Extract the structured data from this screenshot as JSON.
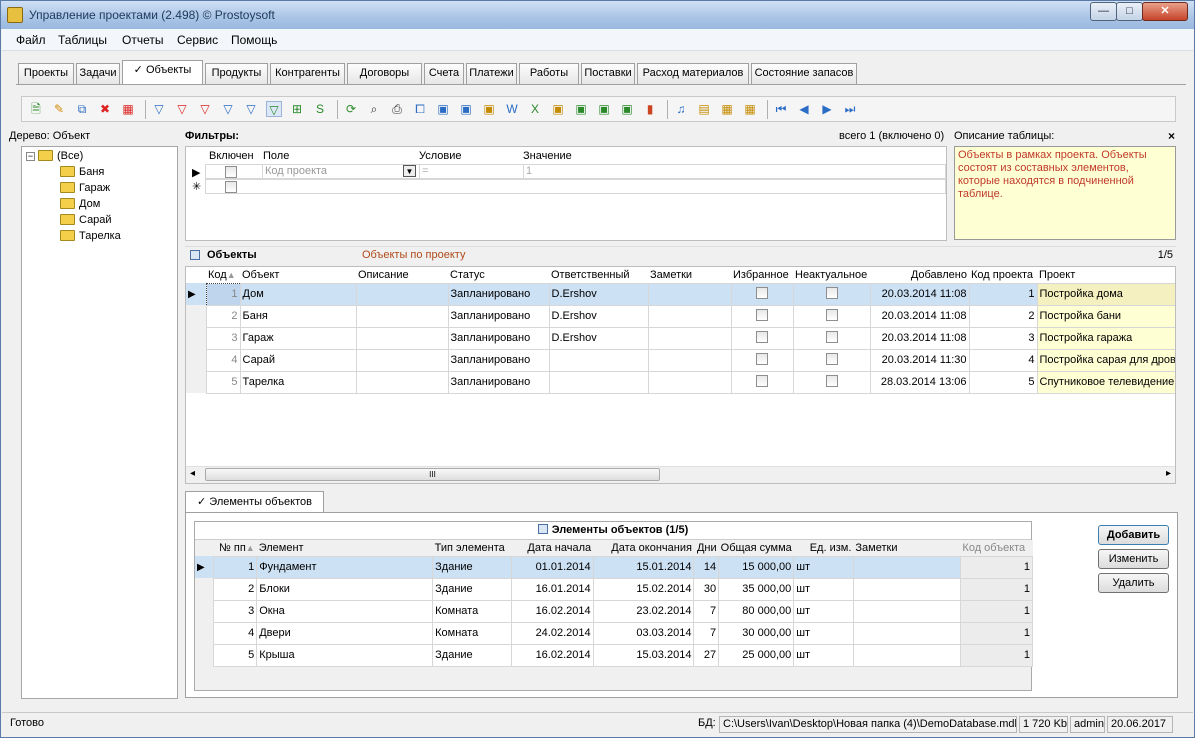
{
  "window": {
    "title": "Управление проектами (2.498) © Prostoysoft",
    "min": "—",
    "max": "□",
    "close": "✕"
  },
  "menu": [
    "Файл",
    "Таблицы",
    "Отчеты",
    "Сервис",
    "Помощь"
  ],
  "tabs": [
    {
      "label": "Проекты",
      "active": false
    },
    {
      "label": "Задачи",
      "active": false
    },
    {
      "label": "✓ Объекты",
      "active": true
    },
    {
      "label": "Продукты",
      "active": false
    },
    {
      "label": "Контрагенты",
      "active": false
    },
    {
      "label": "Договоры",
      "active": false
    },
    {
      "label": "Счета",
      "active": false
    },
    {
      "label": "Платежи",
      "active": false
    },
    {
      "label": "Работы",
      "active": false
    },
    {
      "label": "Поставки",
      "active": false
    },
    {
      "label": "Расход материалов",
      "active": false
    },
    {
      "label": "Состояние запасов",
      "active": false
    }
  ],
  "toolbar_icons": [
    {
      "name": "new-record-icon",
      "glyph": "🗎",
      "color": "#2a8a2a"
    },
    {
      "name": "edit-record-icon",
      "glyph": "✎",
      "color": "#d08a00"
    },
    {
      "name": "copy-record-icon",
      "glyph": "⧉",
      "color": "#2b6cc4"
    },
    {
      "name": "delete-record-icon",
      "glyph": "✖",
      "color": "#d22"
    },
    {
      "name": "delete-all-icon",
      "glyph": "▦",
      "color": "#d22"
    },
    {
      "name": "filter-icon",
      "glyph": "▽",
      "color": "#2b6cc4"
    },
    {
      "name": "filter-remove-icon",
      "glyph": "▽",
      "color": "#d22"
    },
    {
      "name": "filter-clear-icon",
      "glyph": "▽",
      "color": "#d22"
    },
    {
      "name": "filter-add-icon",
      "glyph": "▽",
      "color": "#2b6cc4"
    },
    {
      "name": "filter-edit-icon",
      "glyph": "▽",
      "color": "#2b6cc4"
    },
    {
      "name": "filter-panel-icon",
      "glyph": "▽",
      "color": "#2a8a2a"
    },
    {
      "name": "filter-tree-icon",
      "glyph": "⊞",
      "color": "#2a8a2a"
    },
    {
      "name": "sql-filter-icon",
      "glyph": "S",
      "color": "#2a8a2a"
    },
    {
      "name": "refresh-icon",
      "glyph": "⟳",
      "color": "#2a8a2a"
    },
    {
      "name": "find-icon",
      "glyph": "⌕",
      "color": "#333"
    },
    {
      "name": "print-icon",
      "glyph": "⎙",
      "color": "#333"
    },
    {
      "name": "preview-icon",
      "glyph": "⧠",
      "color": "#2b6cc4"
    },
    {
      "name": "export-icon",
      "glyph": "▣",
      "color": "#2b6cc4"
    },
    {
      "name": "export-html-icon",
      "glyph": "▣",
      "color": "#2b6cc4"
    },
    {
      "name": "export-xml-icon",
      "glyph": "▣",
      "color": "#c48a00"
    },
    {
      "name": "export-word-icon",
      "glyph": "W",
      "color": "#2b6cc4"
    },
    {
      "name": "export-excel-icon",
      "glyph": "X",
      "color": "#2a8a2a"
    },
    {
      "name": "export-rtf-icon",
      "glyph": "▣",
      "color": "#c48a00"
    },
    {
      "name": "export-csv-icon",
      "glyph": "▣",
      "color": "#2a8a2a"
    },
    {
      "name": "export-txt-icon",
      "glyph": "▣",
      "color": "#2a8a2a"
    },
    {
      "name": "export-dbf-icon",
      "glyph": "▣",
      "color": "#2a8a2a"
    },
    {
      "name": "chart-icon",
      "glyph": "▮",
      "color": "#c42"
    },
    {
      "name": "report-icon",
      "glyph": "♫",
      "color": "#2b6cc4"
    },
    {
      "name": "report-export-icon",
      "glyph": "▤",
      "color": "#c48a00"
    },
    {
      "name": "grid-settings-icon",
      "glyph": "▦",
      "color": "#c48a00"
    },
    {
      "name": "grid-columns-icon",
      "glyph": "▦",
      "color": "#c48a00"
    },
    {
      "name": "first-record-icon",
      "glyph": "⏮",
      "color": "#2b6cc4"
    },
    {
      "name": "prev-record-icon",
      "glyph": "◀",
      "color": "#2b6cc4"
    },
    {
      "name": "next-record-icon",
      "glyph": "▶",
      "color": "#2b6cc4"
    },
    {
      "name": "last-record-icon",
      "glyph": "⏭",
      "color": "#2b6cc4"
    }
  ],
  "tree": {
    "title": "Дерево: Объект",
    "root": "(Все)",
    "expander": "−",
    "items": [
      "Баня",
      "Гараж",
      "Дом",
      "Сарай",
      "Тарелка"
    ]
  },
  "filters": {
    "title": "Фильтры:",
    "total": "всего 1 (включено 0)",
    "columns": [
      "Включен",
      "Поле",
      "Условие",
      "Значение"
    ],
    "row": {
      "field": "Код проекта",
      "condition": "=",
      "value": "1"
    },
    "new_row_marker": "✳",
    "current_marker": "▶"
  },
  "description": {
    "title": "Описание таблицы:",
    "close": "×",
    "text": "Объекты в рамках проекта. Объекты состоят из составных элементов, которые находятся в подчиненной таблице."
  },
  "objects": {
    "title": "Объекты",
    "subtitle": "Объекты по проекту",
    "counter": "1/5",
    "columns": [
      "Код",
      "Объект",
      "Описание",
      "Статус",
      "Ответственный",
      "Заметки",
      "Избранное",
      "Неактуальное",
      "Добавлено",
      "Код проекта",
      "Проект"
    ],
    "rows": [
      {
        "code": "1",
        "name": "Дом",
        "desc": "",
        "status": "Запланировано",
        "owner": "D.Ershov",
        "notes": "",
        "added": "20.03.2014 11:08",
        "project_code": "1",
        "project": "Постройка дома"
      },
      {
        "code": "2",
        "name": "Баня",
        "desc": "",
        "status": "Запланировано",
        "owner": "D.Ershov",
        "notes": "",
        "added": "20.03.2014 11:08",
        "project_code": "2",
        "project": "Постройка бани"
      },
      {
        "code": "3",
        "name": "Гараж",
        "desc": "",
        "status": "Запланировано",
        "owner": "D.Ershov",
        "notes": "",
        "added": "20.03.2014 11:08",
        "project_code": "3",
        "project": "Постройка гаража"
      },
      {
        "code": "4",
        "name": "Сарай",
        "desc": "",
        "status": "Запланировано",
        "owner": "",
        "notes": "",
        "added": "20.03.2014 11:30",
        "project_code": "4",
        "project": "Постройка сарая для дров"
      },
      {
        "code": "5",
        "name": "Тарелка",
        "desc": "",
        "status": "Запланировано",
        "owner": "",
        "notes": "",
        "added": "28.03.2014 13:06",
        "project_code": "5",
        "project": "Спутниковое телевидение"
      }
    ],
    "scroll_thumb": "III",
    "scroll_left": "◂",
    "scroll_right": "▸"
  },
  "elements": {
    "tab": "✓ Элементы объектов",
    "title": "Элементы объектов (1/5)",
    "columns": [
      "№ пп",
      "Элемент",
      "Тип элемента",
      "Дата начала",
      "Дата окончания",
      "Дни",
      "Общая сумма",
      "Ед. изм.",
      "Заметки",
      "Код объекта"
    ],
    "rows": [
      {
        "n": "1",
        "name": "Фундамент",
        "type": "Здание",
        "start": "01.01.2014",
        "end": "15.01.2014",
        "days": "14",
        "sum": "15 000,00",
        "unit": "шт",
        "notes": "",
        "obj": "1"
      },
      {
        "n": "2",
        "name": "Блоки",
        "type": "Здание",
        "start": "16.01.2014",
        "end": "15.02.2014",
        "days": "30",
        "sum": "35 000,00",
        "unit": "шт",
        "notes": "",
        "obj": "1"
      },
      {
        "n": "3",
        "name": "Окна",
        "type": "Комната",
        "start": "16.02.2014",
        "end": "23.02.2014",
        "days": "7",
        "sum": "80 000,00",
        "unit": "шт",
        "notes": "",
        "obj": "1"
      },
      {
        "n": "4",
        "name": "Двери",
        "type": "Комната",
        "start": "24.02.2014",
        "end": "03.03.2014",
        "days": "7",
        "sum": "30 000,00",
        "unit": "шт",
        "notes": "",
        "obj": "1"
      },
      {
        "n": "5",
        "name": "Крыша",
        "type": "Здание",
        "start": "16.02.2014",
        "end": "15.03.2014",
        "days": "27",
        "sum": "25 000,00",
        "unit": "шт",
        "notes": "",
        "obj": "1"
      }
    ],
    "buttons": {
      "add": "Добавить",
      "edit": "Изменить",
      "delete": "Удалить"
    }
  },
  "status": {
    "text": "Готово",
    "db_label": "БД:",
    "db_path": "C:\\Users\\Ivan\\Desktop\\Новая папка (4)\\DemoDatabase.mdb",
    "size": "1 720 Kb",
    "user": "admin",
    "date": "20.06.2017"
  }
}
